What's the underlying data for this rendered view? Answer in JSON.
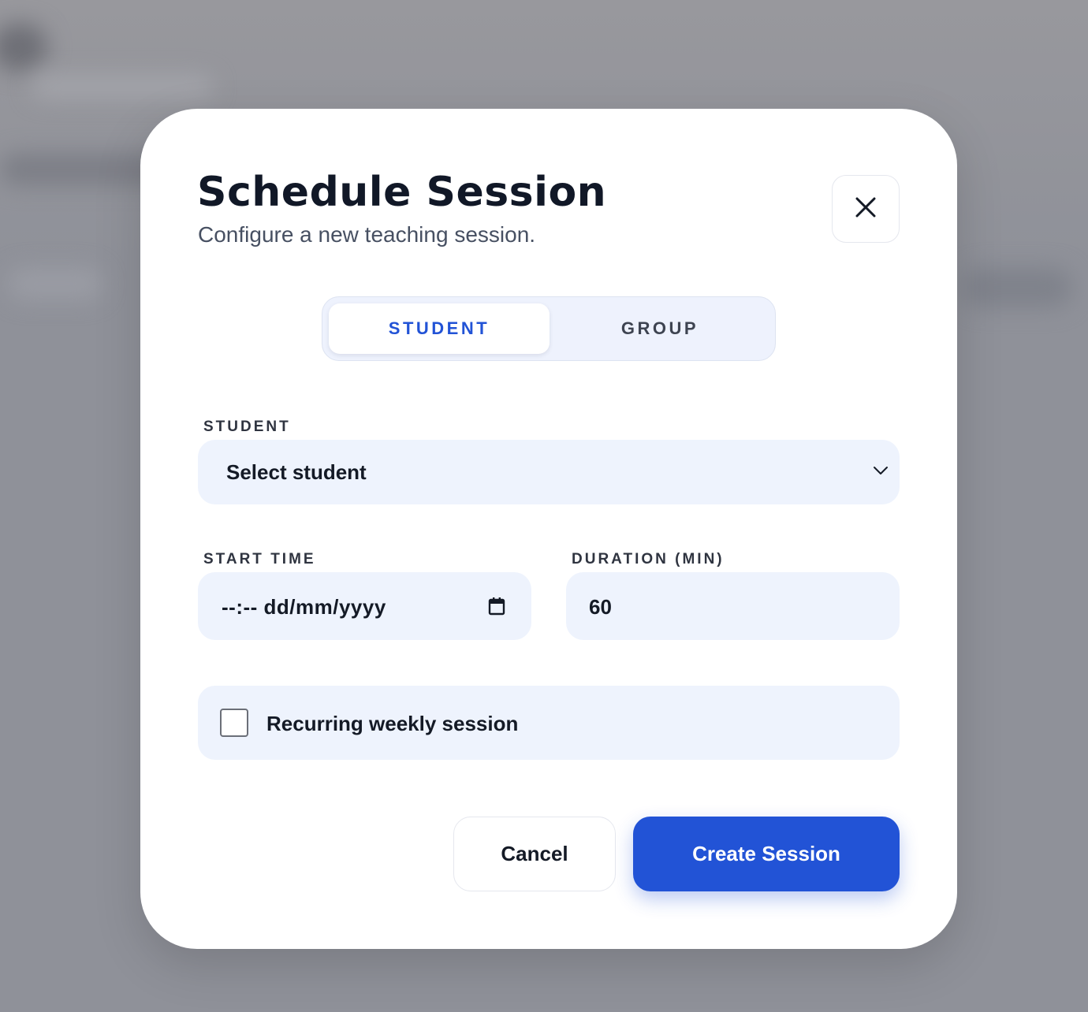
{
  "modal": {
    "title": "Schedule Session",
    "subtitle": "Configure a new teaching session.",
    "close_icon": "close-icon"
  },
  "mode_toggle": {
    "options": [
      {
        "label": "STUDENT",
        "selected": true
      },
      {
        "label": "GROUP",
        "selected": false
      }
    ]
  },
  "form": {
    "student": {
      "label": "STUDENT",
      "value": "Select student",
      "icon": "chevron-down-icon"
    },
    "start_time": {
      "label": "START TIME",
      "value": "--:-- dd/mm/yyyy",
      "icon": "calendar-icon"
    },
    "duration": {
      "label": "DURATION (MIN)",
      "value": "60"
    },
    "recurring": {
      "label": "Recurring weekly session",
      "checked": false
    }
  },
  "actions": {
    "cancel_label": "Cancel",
    "create_label": "Create Session"
  },
  "colors": {
    "accent": "#2253d6",
    "overlay": "#8f9199",
    "field_bg": "#eef3fd",
    "title_text": "#111827"
  }
}
